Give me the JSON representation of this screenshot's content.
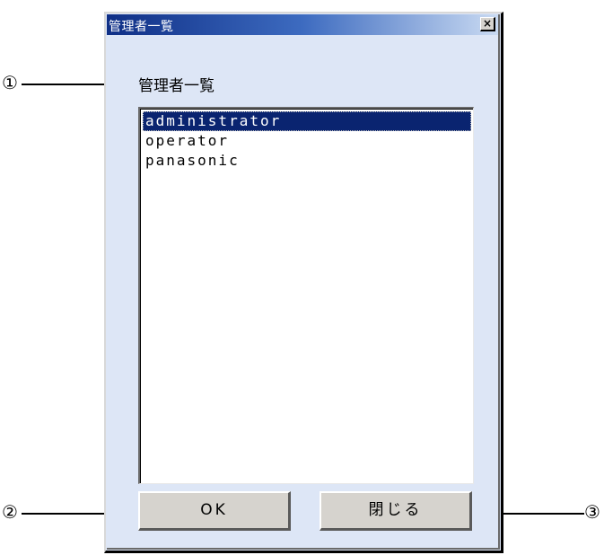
{
  "dialog": {
    "title": "管理者一覧",
    "close_glyph": "×"
  },
  "list": {
    "label": "管理者一覧",
    "items": [
      "administrator",
      "operator",
      "panasonic"
    ],
    "selected": "administrator"
  },
  "buttons": {
    "ok_label": "OK",
    "close_label": "閉じる"
  },
  "callouts": [
    "①",
    "②",
    "③"
  ],
  "colors": {
    "dialog_bg": "#dde6f6",
    "titlebar_start": "#0f2f86",
    "selection_bg": "#0a2470",
    "button_face": "#d6d3ce"
  }
}
